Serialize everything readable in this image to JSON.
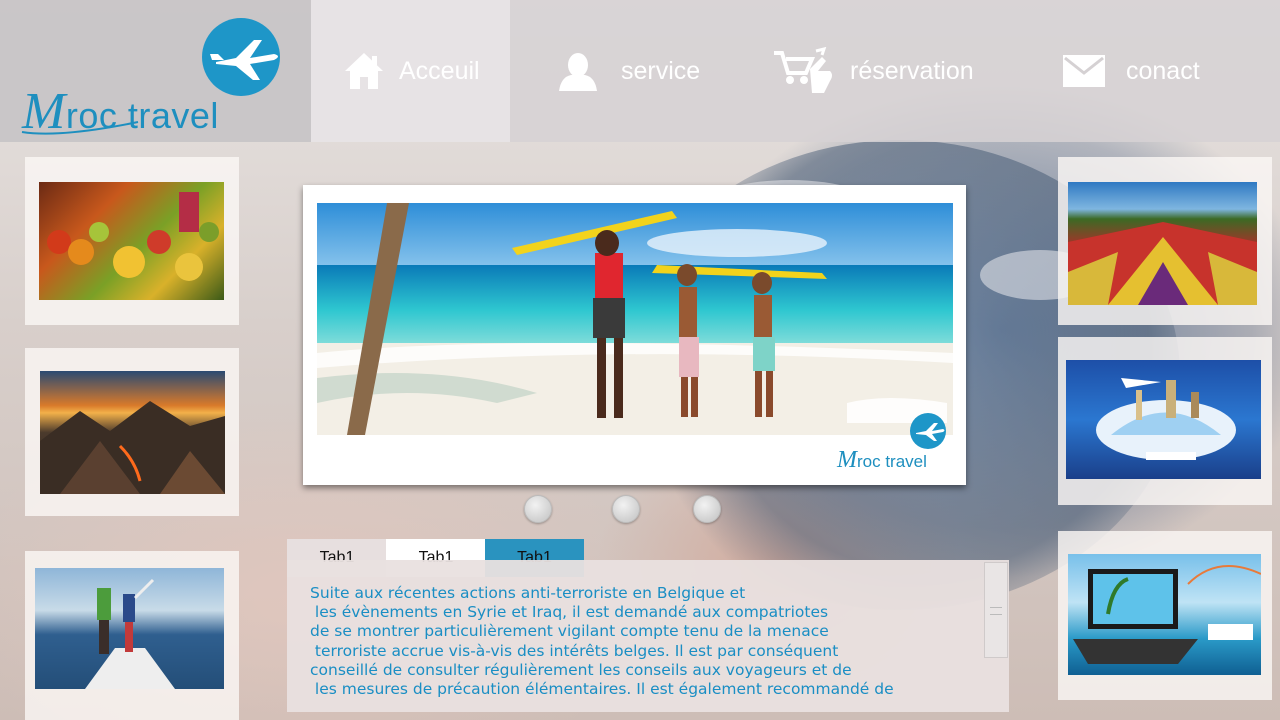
{
  "logo": {
    "initial": "M",
    "rest": "roc travel"
  },
  "nav": [
    {
      "label": "Acceuil",
      "icon": "home-icon"
    },
    {
      "label": "service",
      "icon": "user-icon"
    },
    {
      "label": "réservation",
      "icon": "hand-cart-icon"
    },
    {
      "label": "conact",
      "icon": "mail-icon"
    }
  ],
  "slider": {
    "watermark_initial": "M",
    "watermark_rest": "roc travel",
    "active_slide": 1,
    "slide_count": 3
  },
  "tabs": [
    "Tab1",
    "Tab1",
    "Tab1"
  ],
  "content": {
    "text": "Suite aux récentes actions anti-terroriste en Belgique et\n les évènements en Syrie et Iraq, il est demandé aux compatriotes\nde se montrer particulièrement vigilant compte tenu de la menace\n terroriste accrue vis-à-vis des intérêts belges. Il est par conséquent\nconseillé de consulter régulièrement les conseils aux voyageurs et de\n les mesures de précaution élémentaires. Il est également recommandé de"
  },
  "colors": {
    "accent": "#1e96c8",
    "tab_active": "#2a93bf",
    "text_blue": "#1a8ec4"
  }
}
